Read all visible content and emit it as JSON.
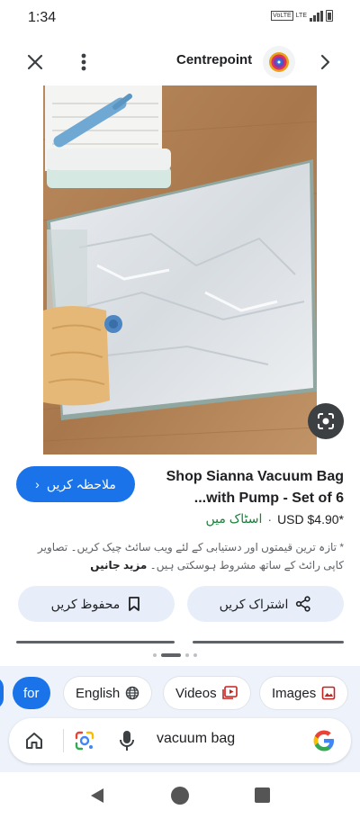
{
  "status_bar": {
    "time": "1:34",
    "network_badge": "VoLTE",
    "network_type": "LTE"
  },
  "top_bar": {
    "site_name": "Centrepoint"
  },
  "product": {
    "title": "Shop Sianna Vacuum Bag with Pump - Set of 6...",
    "price": "USD $4.90*",
    "stock_status": "اسٹاک میں",
    "visit_label": "ملاحظہ کریں",
    "disclaimer": "* تازہ ترین قیمتوں اور دستیابی کے لئے ویب سائٹ چیک کریں۔ تصاویر کاپی رائٹ کے ساتھ مشروط ہوسکتی ہیں۔",
    "more_info": "مزید جانیں"
  },
  "actions": {
    "save_label": "محفوظ کریں",
    "share_label": "اشتراک کریں"
  },
  "chips": [
    {
      "label": "for"
    },
    {
      "label": "English",
      "icon": "globe-icon"
    },
    {
      "label": "Videos",
      "icon": "video-icon"
    },
    {
      "label": "Images",
      "icon": "image-icon"
    }
  ],
  "search": {
    "query": "vacuum bag"
  },
  "colors": {
    "accent": "#1a73e8",
    "stock_green": "#188038",
    "panel": "#eef3fb"
  }
}
